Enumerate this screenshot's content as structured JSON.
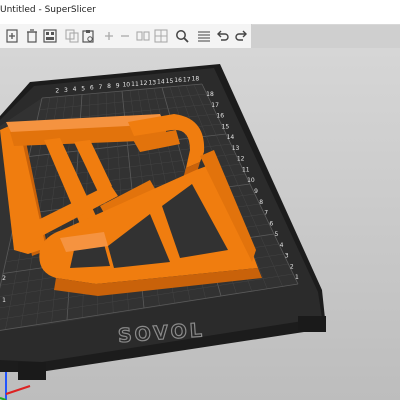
{
  "window": {
    "title": "Untitled - SuperSlicer"
  },
  "toolbar": {
    "buttons": [
      {
        "name": "add-icon",
        "label": "Add"
      },
      {
        "name": "delete-icon",
        "label": "Delete"
      },
      {
        "name": "arrange-icon",
        "label": "Arrange"
      },
      {
        "name": "copy-icon",
        "label": "Copy"
      },
      {
        "name": "paste-icon",
        "label": "Paste"
      },
      {
        "name": "add-instance-icon",
        "label": "Add instance"
      },
      {
        "name": "remove-instance-icon",
        "label": "Remove instance"
      },
      {
        "name": "split-objects-icon",
        "label": "Split to objects"
      },
      {
        "name": "split-parts-icon",
        "label": "Split to parts"
      },
      {
        "name": "search-icon",
        "label": "Search"
      },
      {
        "name": "layers-icon",
        "label": "Layer editing"
      },
      {
        "name": "undo-icon",
        "label": "Undo"
      },
      {
        "name": "redo-icon",
        "label": "Redo"
      }
    ]
  },
  "bed": {
    "brand": "SOVOL",
    "top_ticks": [
      "2",
      "3",
      "4",
      "5",
      "6",
      "7",
      "8",
      "9",
      "10",
      "11",
      "12",
      "13",
      "14",
      "15",
      "16",
      "17",
      "18"
    ],
    "right_ticks": [
      "18",
      "17",
      "16",
      "15",
      "14",
      "13",
      "12",
      "11",
      "10",
      "9",
      "8",
      "7",
      "6",
      "5",
      "4",
      "3",
      "2",
      "1"
    ],
    "left_ticks": [
      "2",
      "1"
    ],
    "colors": {
      "bed": "#2b2b2b",
      "frame": "#1f1f1f",
      "grid": "#4a4a4a",
      "model": "#f07d0f",
      "model_dark": "#c9620a"
    }
  }
}
